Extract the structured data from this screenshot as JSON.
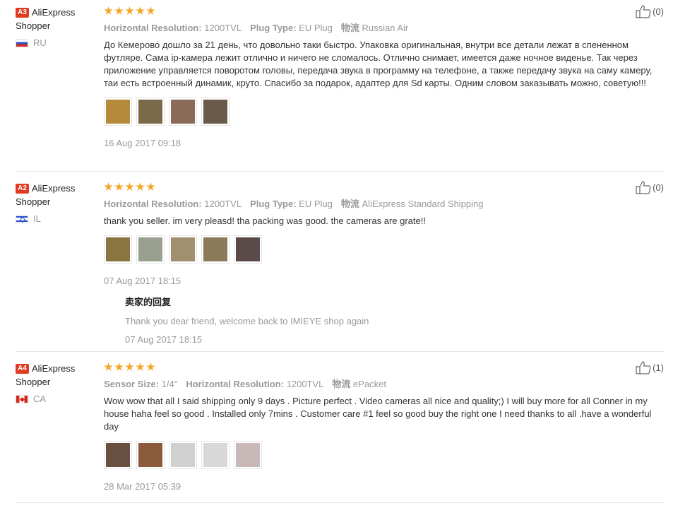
{
  "reviews": [
    {
      "badge": "A3",
      "user": "AliExpress Shopper",
      "country": "RU",
      "flag": "ru",
      "rating_stars": 5,
      "attrs": [
        {
          "k": "Horizontal Resolution:",
          "v": "1200TVL"
        },
        {
          "k": "Plug Type:",
          "v": "EU Plug"
        },
        {
          "k": "物流",
          "v": "Russian Air"
        }
      ],
      "text": "До Кемерово дошло за 21 день, что довольно таки быстро. Упаковка оригинальная, внутри все детали лежат в спененном футляре. Сама ip-камера лежит отлично и ничего не сломалось. Отлично снимает, имеется даже ночное виденье. Так через приложение управляется поворотом головы, передача звука в программу на телефоне, а также передачу звука на саму камеру, таи есть встроенный динамик, круто. Спасибо за подарок, адаптер для Sd карты. Одним словом заказывать можно, советую!!!",
      "photos": [
        "#b58a3a",
        "#7a6a4a",
        "#8a6b57",
        "#6a5a4a"
      ],
      "date": "16 Aug 2017 09:18",
      "likes": "(0)"
    },
    {
      "badge": "A2",
      "user": "AliExpress Shopper",
      "country": "IL",
      "flag": "il",
      "rating_stars": 5,
      "attrs": [
        {
          "k": "Horizontal Resolution:",
          "v": "1200TVL"
        },
        {
          "k": "Plug Type:",
          "v": "EU Plug"
        },
        {
          "k": "物流",
          "v": "AliExpress Standard Shipping"
        }
      ],
      "text": "thank you seller. im very pleasd! tha packing was good. the cameras are grate!!",
      "photos": [
        "#8a7440",
        "#9aa090",
        "#a09070",
        "#8a7a5a",
        "#5a4a4a"
      ],
      "date": "07 Aug 2017 18:15",
      "reply": {
        "title": "卖家的回复",
        "text": "Thank you dear friend, welcome back to IMIEYE shop again",
        "date": "07 Aug 2017 18:15"
      },
      "likes": "(0)"
    },
    {
      "badge": "A4",
      "user": "AliExpress Shopper",
      "country": "CA",
      "flag": "ca",
      "rating_stars": 5,
      "attrs": [
        {
          "k": "Sensor Size:",
          "v": "1/4\""
        },
        {
          "k": "Horizontal Resolution:",
          "v": "1200TVL"
        },
        {
          "k": "物流",
          "v": "ePacket"
        }
      ],
      "text": "Wow wow that all I said shipping only 9 days . Picture perfect . Video cameras all nice and quality;) I will buy more for all Conner in my house haha feel so good . Installed only 7mins . Customer care #1 feel so good buy the right one I need thanks to all .have a wonderful day",
      "photos": [
        "#6a5040",
        "#8a5a3a",
        "#d0d0d0",
        "#d8d8d8",
        "#c8b8b8"
      ],
      "date": "28 Mar 2017 05:39",
      "likes": "(1)"
    }
  ]
}
